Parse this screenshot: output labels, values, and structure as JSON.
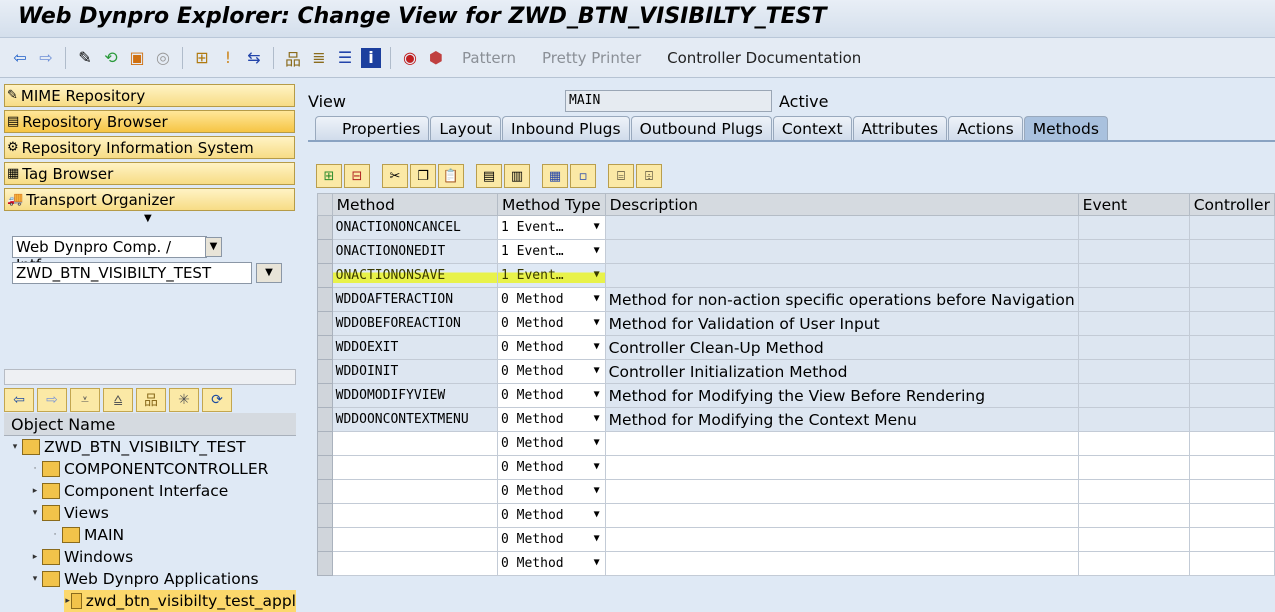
{
  "window": {
    "title": "Web Dynpro Explorer: Change View for ZWD_BTN_VISIBILTY_TEST"
  },
  "toolbar": {
    "pattern": "Pattern",
    "pretty_printer": "Pretty Printer",
    "controller_doc": "Controller Documentation"
  },
  "nav": [
    "MIME Repository",
    "Repository Browser",
    "Repository Information System",
    "Tag Browser",
    "Transport Organizer"
  ],
  "object_type": "Web Dynpro Comp. / Intf.",
  "object_name": "ZWD_BTN_VISIBILTY_TEST",
  "tree_header": "Object Name",
  "tree": [
    {
      "label": "ZWD_BTN_VISIBILTY_TEST",
      "level": 0,
      "exp": "▾"
    },
    {
      "label": "COMPONENTCONTROLLER",
      "level": 1,
      "exp": "·"
    },
    {
      "label": "Component Interface",
      "level": 1,
      "exp": "▸"
    },
    {
      "label": "Views",
      "level": 1,
      "exp": "▾"
    },
    {
      "label": "MAIN",
      "level": 2,
      "exp": "·"
    },
    {
      "label": "Windows",
      "level": 1,
      "exp": "▸"
    },
    {
      "label": "Web Dynpro Applications",
      "level": 1,
      "exp": "▾"
    },
    {
      "label": "zwd_btn_visibilty_test_appl",
      "level": 2,
      "exp": "▸",
      "selected": true
    }
  ],
  "view": {
    "label": "View",
    "name": "MAIN",
    "status": "Active"
  },
  "tabs": [
    "Properties",
    "Layout",
    "Inbound Plugs",
    "Outbound Plugs",
    "Context",
    "Attributes",
    "Actions",
    "Methods"
  ],
  "active_tab": "Methods",
  "table": {
    "columns": [
      "Method",
      "Method Type",
      "Description",
      "Event",
      "Controller"
    ],
    "rows": [
      {
        "method": "ONACTIONONCANCEL",
        "type": "1 Event…",
        "desc": ""
      },
      {
        "method": "ONACTIONONEDIT",
        "type": "1 Event…",
        "desc": ""
      },
      {
        "method": "ONACTIONONSAVE",
        "type": "1 Event…",
        "desc": "",
        "highlight": true
      },
      {
        "method": "WDDOAFTERACTION",
        "type": "0 Method",
        "desc": "Method for non-action specific operations before Navigation"
      },
      {
        "method": "WDDOBEFOREACTION",
        "type": "0 Method",
        "desc": "Method for Validation of User Input"
      },
      {
        "method": "WDDOEXIT",
        "type": "0 Method",
        "desc": "Controller Clean-Up Method"
      },
      {
        "method": "WDDOINIT",
        "type": "0 Method",
        "desc": "Controller Initialization Method"
      },
      {
        "method": "WDDOMODIFYVIEW",
        "type": "0 Method",
        "desc": "Method for Modifying the View Before Rendering"
      },
      {
        "method": "WDDOONCONTEXTMENU",
        "type": "0 Method",
        "desc": "Method for Modifying the Context Menu"
      },
      {
        "method": "",
        "type": "0 Method",
        "desc": ""
      },
      {
        "method": "",
        "type": "0 Method",
        "desc": ""
      },
      {
        "method": "",
        "type": "0 Method",
        "desc": ""
      },
      {
        "method": "",
        "type": "0 Method",
        "desc": ""
      },
      {
        "method": "",
        "type": "0 Method",
        "desc": ""
      },
      {
        "method": "",
        "type": "0 Method",
        "desc": ""
      }
    ]
  }
}
